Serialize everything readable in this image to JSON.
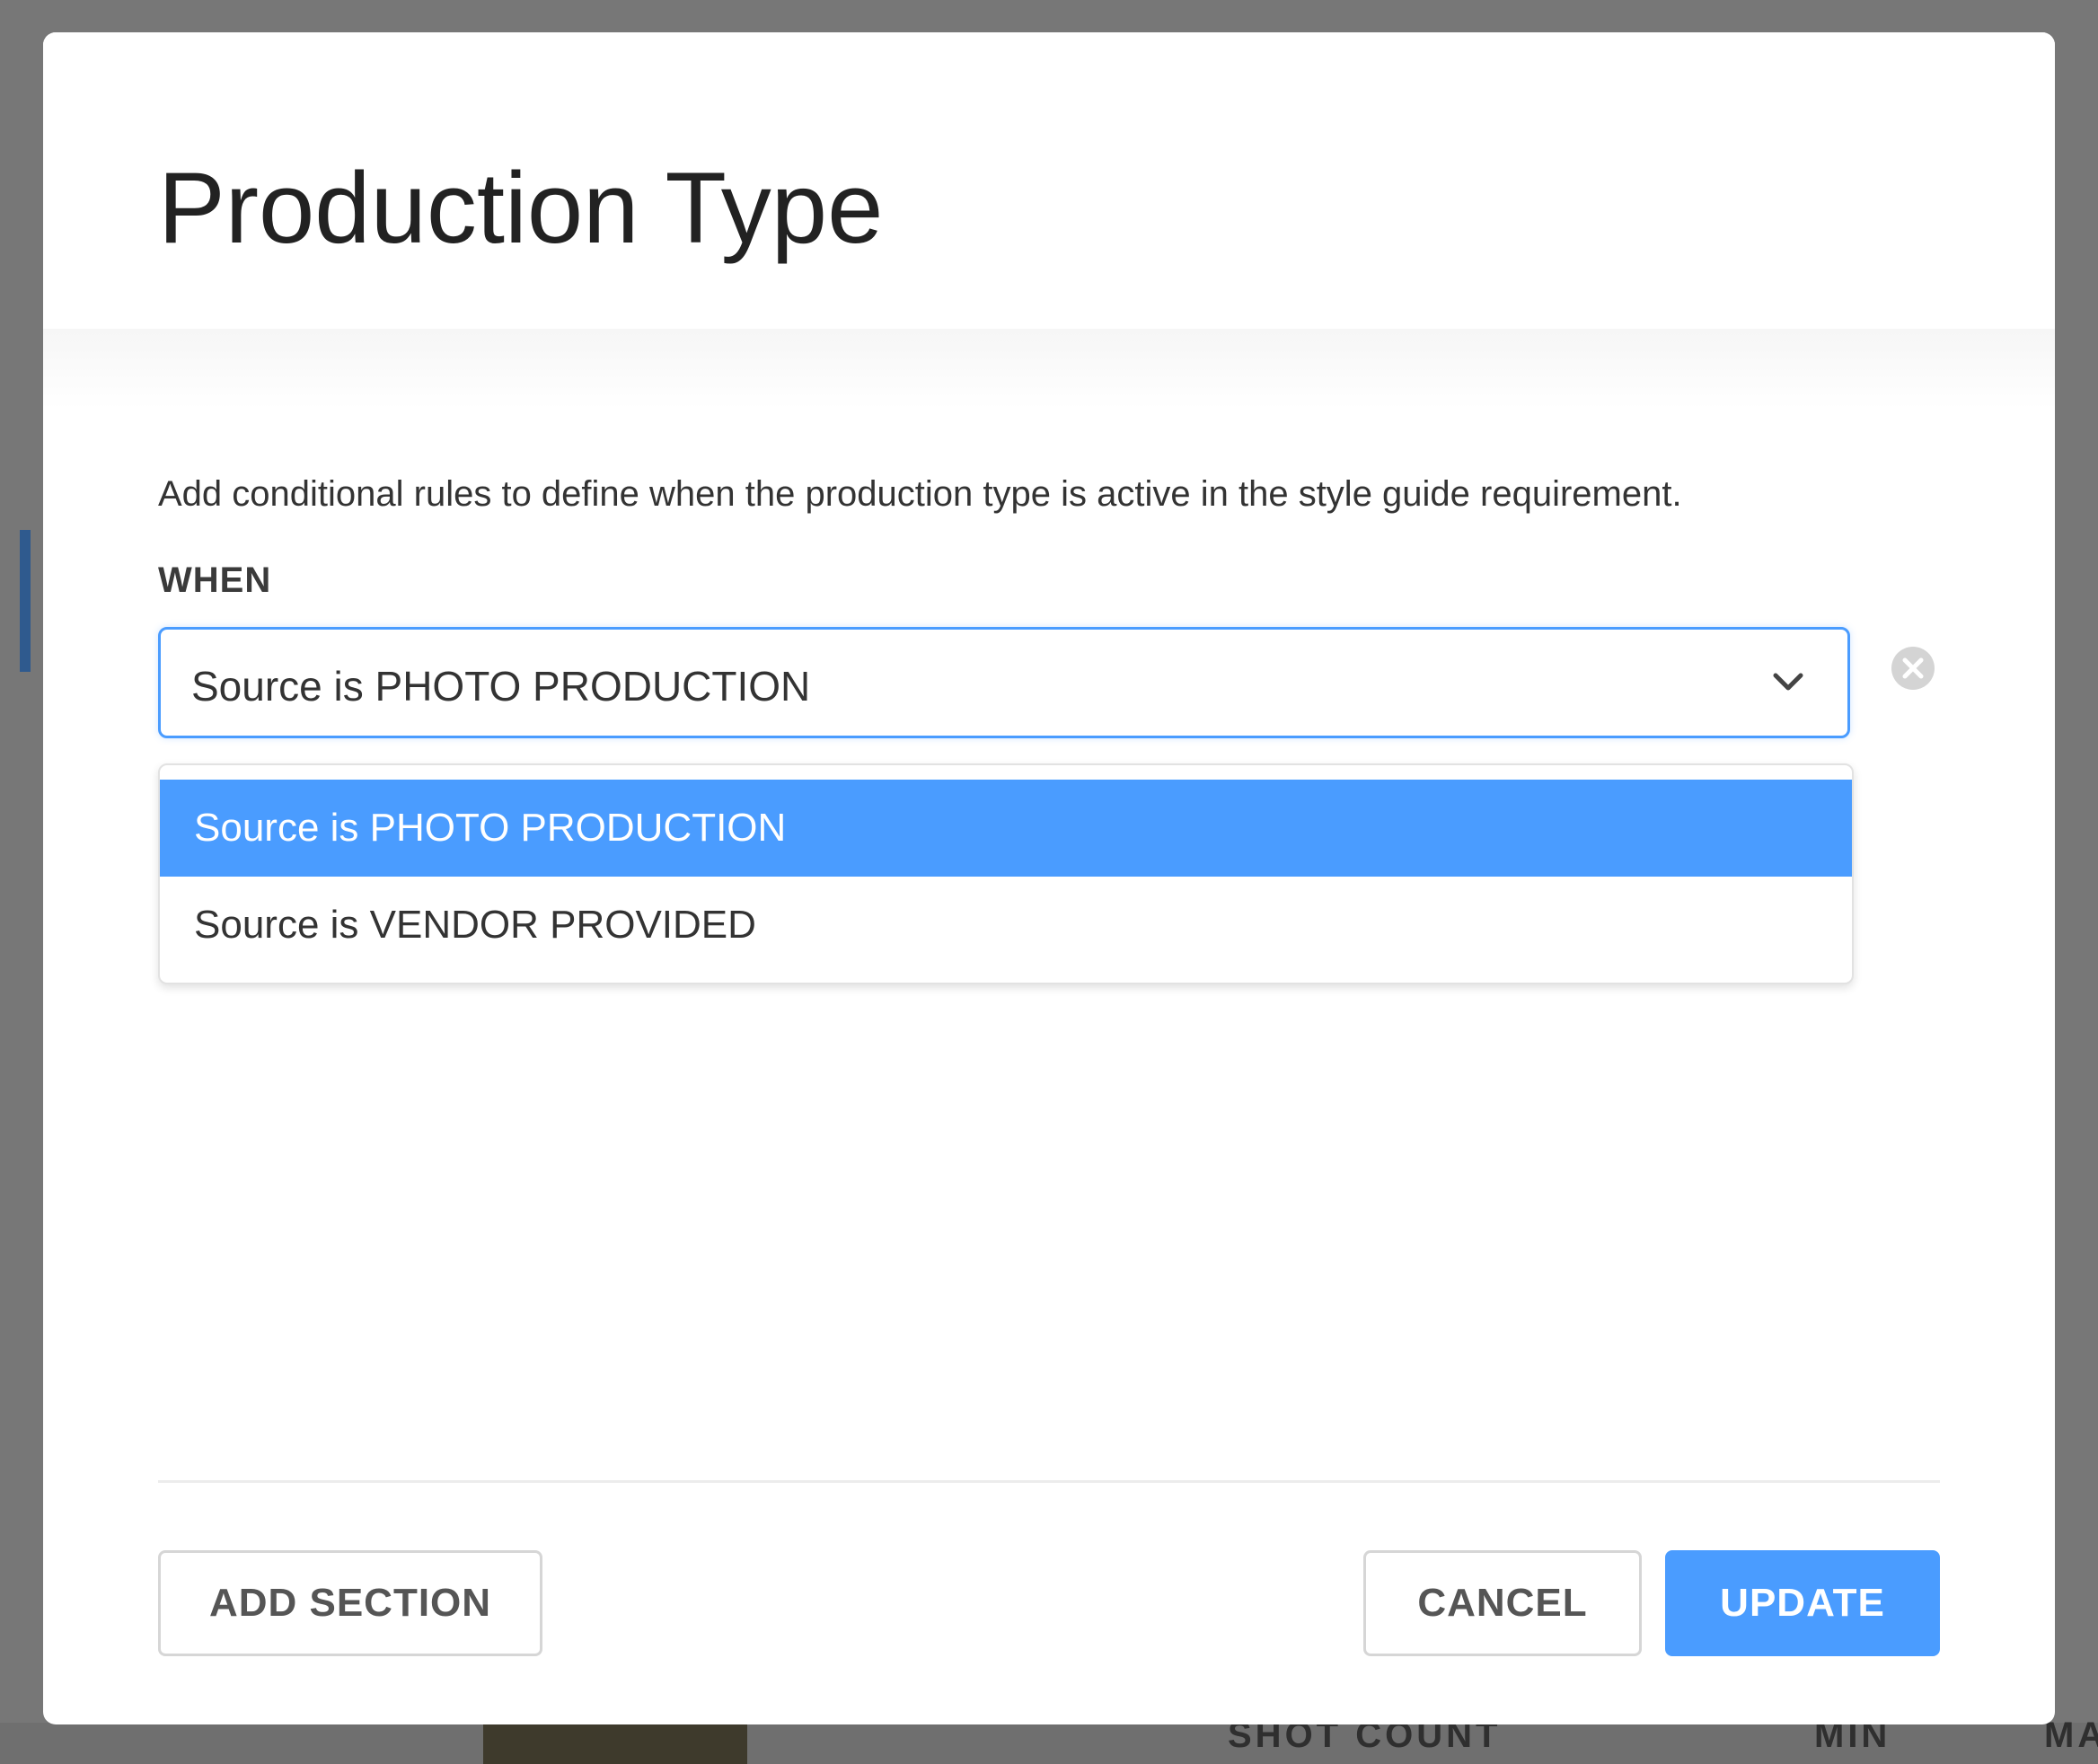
{
  "background": {
    "columns": {
      "shot_count": "SHOT COUNT",
      "min": "MIN",
      "max_partial": "MA"
    }
  },
  "modal": {
    "title": "Production Type",
    "description": "Add conditional rules to define when the production type is active in the style guide requirement.",
    "when_label": "WHEN",
    "select": {
      "value": "Source is PHOTO PRODUCTION",
      "icon": "chevron-down-icon"
    },
    "clear_icon": "close-circle-icon",
    "dropdown": {
      "options": [
        {
          "label": "Source is PHOTO PRODUCTION",
          "selected": true
        },
        {
          "label": "Source is VENDOR PROVIDED",
          "selected": false
        }
      ]
    },
    "footer": {
      "add_section_label": "ADD SECTION",
      "cancel_label": "CANCEL",
      "update_label": "UPDATE"
    }
  },
  "colors": {
    "accent": "#4a9cff",
    "overlay": "#777777",
    "text_dark": "#222222"
  }
}
